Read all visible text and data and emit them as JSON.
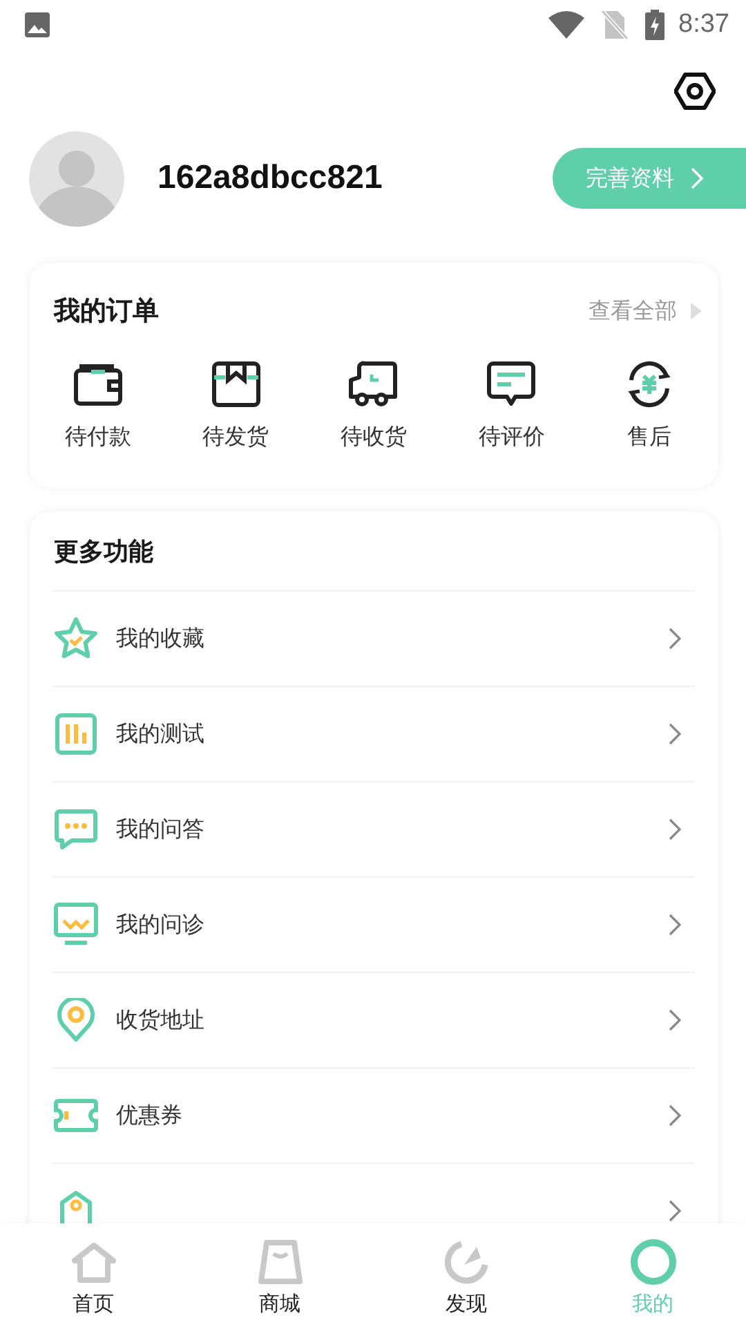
{
  "status_bar": {
    "time": "8:37"
  },
  "profile": {
    "username": "162a8dbcc821",
    "edit_button": "完善资料"
  },
  "orders": {
    "title": "我的订单",
    "view_all": "查看全部",
    "items": [
      {
        "label": "待付款"
      },
      {
        "label": "待发货"
      },
      {
        "label": "待收货"
      },
      {
        "label": "待评价"
      },
      {
        "label": "售后"
      }
    ]
  },
  "more": {
    "title": "更多功能",
    "items": [
      {
        "label": "我的收藏"
      },
      {
        "label": "我的测试"
      },
      {
        "label": "我的问答"
      },
      {
        "label": "我的问诊"
      },
      {
        "label": "收货地址"
      },
      {
        "label": "优惠券"
      },
      {
        "kind": "cut_off"
      }
    ]
  },
  "tab_bar": [
    {
      "label": "首页",
      "selected": false
    },
    {
      "label": "商城",
      "selected": false
    },
    {
      "label": "发现",
      "selected": false
    },
    {
      "label": "我的",
      "selected": true
    }
  ]
}
